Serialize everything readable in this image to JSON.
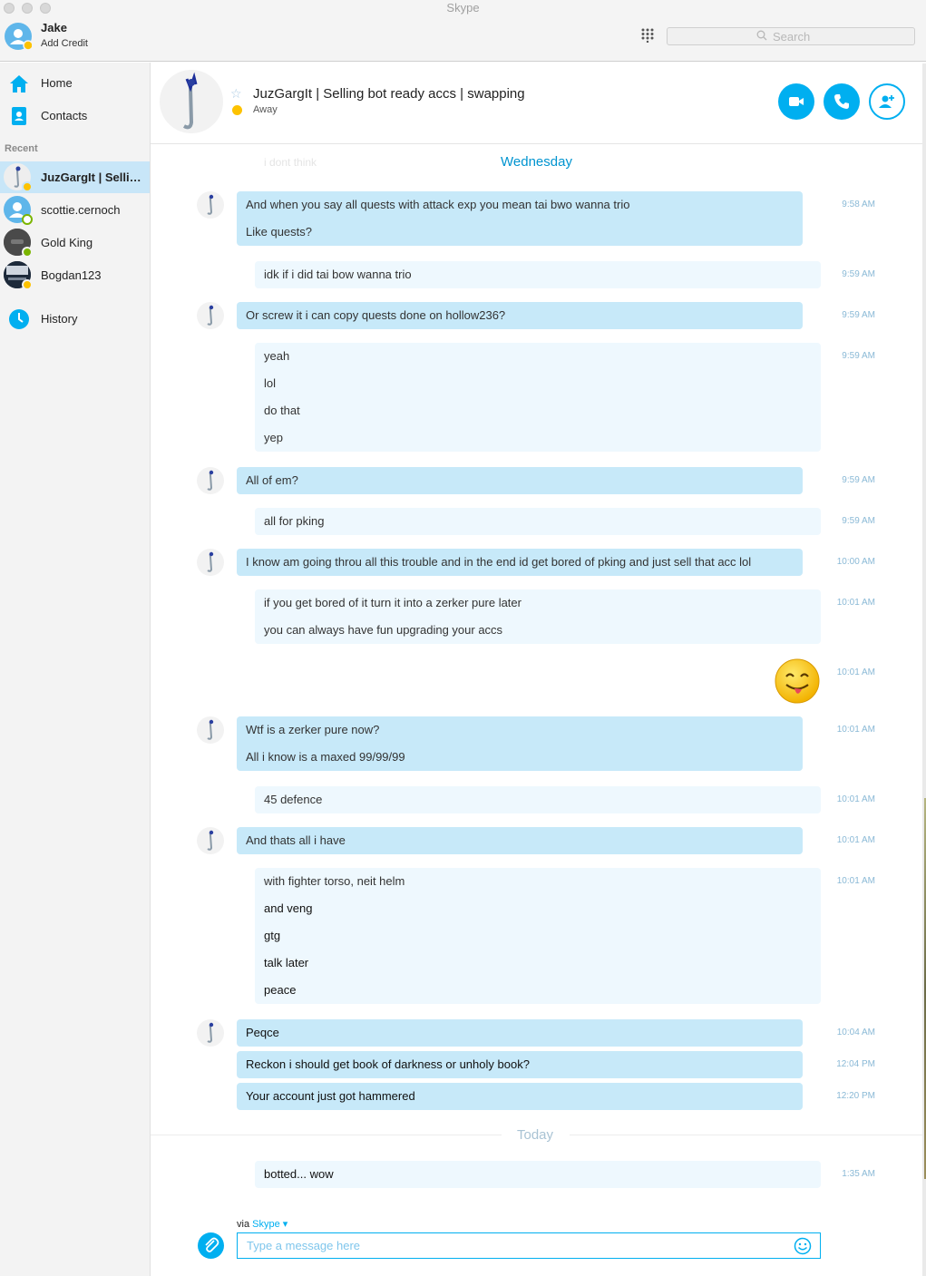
{
  "window": {
    "title": "Skype"
  },
  "account": {
    "name": "Jake",
    "credit_label": "Add Credit"
  },
  "search": {
    "placeholder": "Search"
  },
  "sidebar": {
    "nav": [
      {
        "label": "Home",
        "icon": "home-icon"
      },
      {
        "label": "Contacts",
        "icon": "contacts-icon"
      }
    ],
    "recent_label": "Recent",
    "contacts": [
      {
        "name": "JuzGargIt | Selling bot ready accs | swapping",
        "status": "away",
        "active": true
      },
      {
        "name": "scottie.cernoch",
        "status": "offline"
      },
      {
        "name": "Gold King",
        "status": "online"
      },
      {
        "name": "Bogdan123",
        "status": "away"
      }
    ],
    "history_label": "History"
  },
  "chat": {
    "title": "JuzGargIt | Selling bot ready accs | swapping",
    "status": "Away",
    "faded_text": "i dont think",
    "day_wednesday": "Wednesday",
    "day_today": "Today",
    "messages": [
      {
        "dir": "in",
        "lines": [
          "And when you say all quests with attack exp you mean tai bwo wanna trio",
          "Like quests?"
        ],
        "time": "9:58 AM"
      },
      {
        "dir": "out",
        "lines": [
          "idk if i did tai bow wanna trio"
        ],
        "time": "9:59 AM"
      },
      {
        "dir": "in",
        "lines": [
          "Or screw it i can copy quests done on hollow236?"
        ],
        "time": "9:59 AM"
      },
      {
        "dir": "out",
        "lines": [
          "yeah",
          "lol",
          "do that",
          "yep"
        ],
        "time": "9:59 AM"
      },
      {
        "dir": "in",
        "lines": [
          "All of em?"
        ],
        "time": "9:59 AM"
      },
      {
        "dir": "out",
        "lines": [
          "all for pking"
        ],
        "time": "9:59 AM"
      },
      {
        "dir": "in",
        "lines": [
          "I know am going throu all this trouble and in the end id get bored of pking and just sell that acc lol"
        ],
        "time": "10:00 AM"
      },
      {
        "dir": "out",
        "lines": [
          "if you get bored of it turn it into a zerker pure later",
          "you can always have fun upgrading your accs"
        ],
        "time": "10:01 AM"
      },
      {
        "dir": "out",
        "emoji": "tongue-out-smiley",
        "time": "10:01 AM"
      },
      {
        "dir": "in",
        "lines": [
          "Wtf is a zerker pure now?",
          "All i know is a maxed 99/99/99"
        ],
        "time": "10:01 AM"
      },
      {
        "dir": "out",
        "lines": [
          "45 defence"
        ],
        "time": "10:01 AM"
      },
      {
        "dir": "in",
        "lines": [
          "And thats all i have"
        ],
        "time": "10:01 AM"
      },
      {
        "dir": "out",
        "lines": [
          "with fighter torso, neit helm",
          "and veng",
          "gtg",
          "talk later",
          "peace"
        ],
        "time": "10:01 AM"
      },
      {
        "dir": "in",
        "lines": [
          "Peqce"
        ],
        "time": "10:04 AM"
      },
      {
        "dir": "in",
        "lines": [
          "Reckon i should get book of darkness or unholy book?"
        ],
        "time": "12:04 PM"
      },
      {
        "dir": "in",
        "lines": [
          "Your account just got hammered"
        ],
        "time": "12:20 PM"
      },
      {
        "dir": "out",
        "lines": [
          "botted... wow"
        ],
        "time": "1:35 AM"
      }
    ]
  },
  "composer": {
    "via_label": "via",
    "via_service": "Skype",
    "placeholder": "Type a message here"
  },
  "colors": {
    "accent": "#00aff0",
    "incoming_bubble": "#c7e9f9",
    "outgoing_bubble": "#eef8fe",
    "away": "#fdc200",
    "online": "#7bb500"
  }
}
